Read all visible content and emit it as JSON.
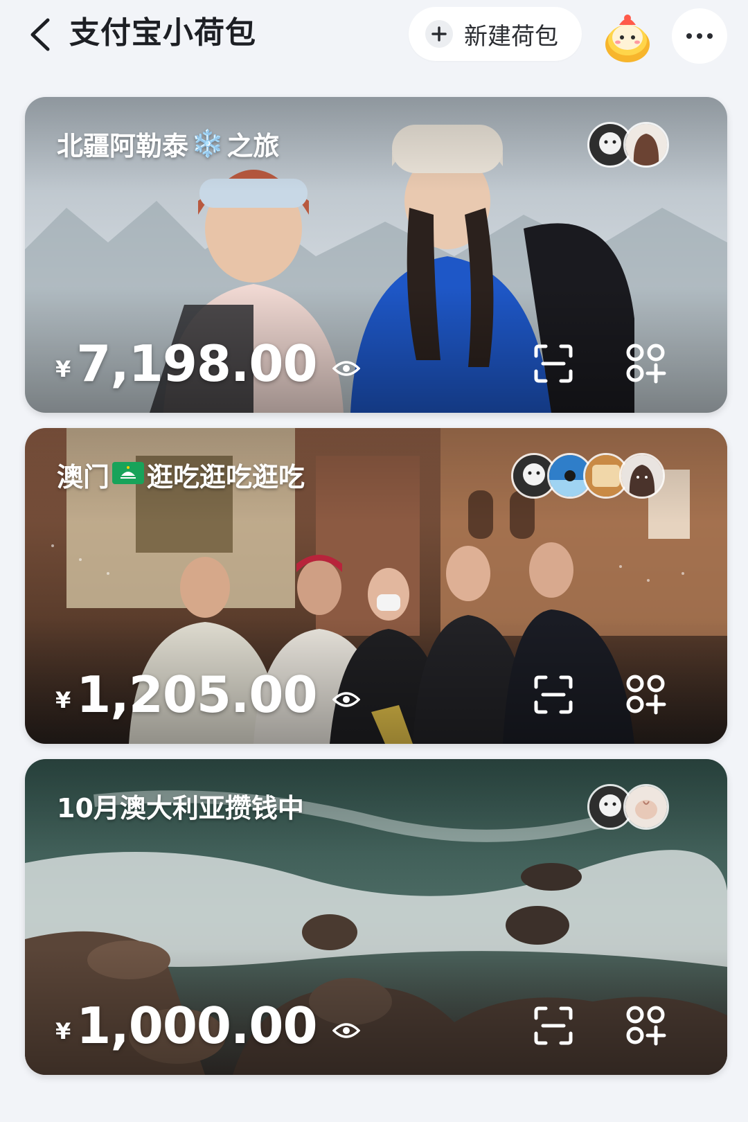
{
  "header": {
    "title": "支付宝小荷包",
    "new_button_label": "新建荷包",
    "back_icon": "back-arrow-icon",
    "more_icon": "more-dots-icon"
  },
  "cards": [
    {
      "title_before": "北疆阿勒泰",
      "title_emoji": "❄️",
      "title_after": "之旅",
      "currency": "¥",
      "amount": "7,198.00",
      "member_count": 2,
      "theme_color": "#c9d2da"
    },
    {
      "title_before": "澳门",
      "title_emoji": "🇲🇴",
      "title_after": "逛吃逛吃逛吃",
      "currency": "¥",
      "amount": "1,205.00",
      "member_count": 4,
      "theme_color": "#8a5a3c"
    },
    {
      "title_before": "10月澳大利亚攒钱中",
      "title_emoji": "",
      "title_after": "",
      "currency": "¥",
      "amount": "1,000.00",
      "member_count": 2,
      "theme_color": "#3d5a52"
    }
  ],
  "colors": {
    "page_bg": "#f2f4f8",
    "title_text": "#1d1f24",
    "card_text": "#ffffff"
  }
}
